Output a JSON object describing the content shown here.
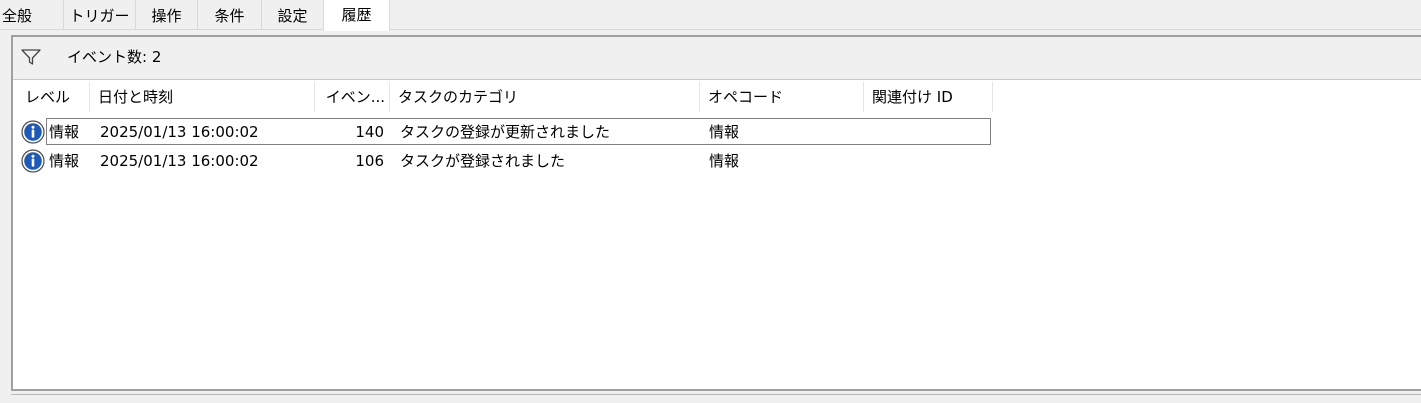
{
  "tabs": [
    {
      "label": "全般",
      "active": false
    },
    {
      "label": "トリガー",
      "active": false
    },
    {
      "label": "操作",
      "active": false
    },
    {
      "label": "条件",
      "active": false
    },
    {
      "label": "設定",
      "active": false
    },
    {
      "label": "履歴",
      "active": true
    }
  ],
  "filter": {
    "icon": "filter-icon",
    "event_count_text": "イベント数: 2"
  },
  "table": {
    "columns": [
      "レベル",
      "日付と時刻",
      "イベン...",
      "タスクのカテゴリ",
      "オペコード",
      "関連付け ID"
    ],
    "rows": [
      {
        "icon": "information-icon",
        "level": "情報",
        "datetime": "2025/01/13 16:00:02",
        "event_id": "140",
        "category": "タスクの登録が更新されました",
        "opcode": "情報",
        "correlation_id": "",
        "focused": true
      },
      {
        "icon": "information-icon",
        "level": "情報",
        "datetime": "2025/01/13 16:00:02",
        "event_id": "106",
        "category": "タスクが登録されました",
        "opcode": "情報",
        "correlation_id": "",
        "focused": false
      }
    ]
  },
  "colors": {
    "window_bg": "#f0f0f0",
    "list_bg": "#ffffff",
    "info_icon_blue": "#1e5bb8"
  }
}
